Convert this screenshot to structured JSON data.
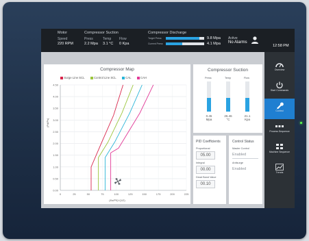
{
  "topbar": {
    "motor_label": "Motor",
    "speed_label": "Speed",
    "speed_value": "220 RPM",
    "compressor_suction_label": "Compressor Suction",
    "press_label": "Press",
    "press_value": "2.2 Mpa",
    "temp_label": "Temp",
    "temp_value": "3.1 °C",
    "flow_label": "Flow",
    "flow_value": "0 Kpa",
    "compressor_discharge_label": "Compressor Discharge",
    "target_press_label": "Target Press",
    "target_press_value": "9.8 Mpa",
    "target_press_fraction": 0.88,
    "current_press_label": "Current Press",
    "current_press_value": "4.1 Mpa",
    "current_press_fraction": 0.42,
    "alarm_label": "Active",
    "alarm_value": "No Alarms",
    "clock": "12:58 PM",
    "user_icon": "user-icon"
  },
  "sidebar": {
    "items": [
      {
        "label": "Overview",
        "icon": "gauge-icon",
        "active": false
      },
      {
        "label": "Start Commands",
        "icon": "power-icon",
        "active": false
      },
      {
        "label": "Control",
        "icon": "wrench-icon",
        "active": true
      },
      {
        "label": "Process Sequence",
        "icon": "sequence-icon",
        "active": false
      },
      {
        "label": "Machine Sequence",
        "icon": "machine-icon",
        "active": false
      },
      {
        "label": "Trends",
        "icon": "trend-icon",
        "active": false
      }
    ]
  },
  "compressor_map": {
    "title": "Compressor Map",
    "legend": [
      {
        "name": "Surge Line SCL",
        "color": "#d9254b"
      },
      {
        "name": "Control Line SCL",
        "color": "#9bc63c"
      },
      {
        "name": "CAL",
        "color": "#2ab5d8"
      },
      {
        "name": "CAH",
        "color": "#e23a97"
      }
    ],
    "xlabel": "(Ks/P0)^(1/2)",
    "ylabel": "(Pd/Ps)",
    "cursor_icon": "fan-icon"
  },
  "chart_data": {
    "type": "line",
    "title": "Compressor Map",
    "xlabel": "(Ks/P0)^(1/2)",
    "ylabel": "(Pd/Ps)",
    "xlim": [
      0,
      225
    ],
    "ylim": [
      0,
      4.5
    ],
    "x_ticks": [
      0,
      25,
      50,
      75,
      100,
      125,
      150,
      175,
      200,
      225
    ],
    "y_ticks": [
      "0.00",
      "0.50",
      "1.00",
      "1.50",
      "2.00",
      "2.50",
      "3.00",
      "3.50",
      "4.00",
      "4.50"
    ],
    "grid": true,
    "legend_position": "top",
    "series": [
      {
        "name": "Surge Line SCL",
        "color": "#d9254b",
        "points": [
          [
            55,
            0
          ],
          [
            55,
            1.0
          ],
          [
            74,
            2.05
          ],
          [
            95,
            3.2
          ],
          [
            112,
            4.5
          ]
        ]
      },
      {
        "name": "Control Line SCL",
        "color": "#9bc63c",
        "points": [
          [
            68,
            0
          ],
          [
            68,
            1.4
          ],
          [
            85,
            2.05
          ],
          [
            110,
            3.3
          ],
          [
            130,
            4.5
          ]
        ]
      },
      {
        "name": "CAL",
        "color": "#2ab5d8",
        "points": [
          [
            80,
            0
          ],
          [
            80,
            1.4
          ],
          [
            97,
            2.05
          ],
          [
            124,
            3.3
          ],
          [
            146,
            4.5
          ]
        ]
      },
      {
        "name": "CAH",
        "color": "#e23a97",
        "points": [
          [
            90,
            0
          ],
          [
            90,
            1.6
          ],
          [
            104,
            1.8
          ],
          [
            142,
            3.3
          ],
          [
            166,
            4.5
          ]
        ]
      }
    ]
  },
  "suction": {
    "title": "Compressor Suction",
    "gauges": [
      {
        "label": "Press",
        "value": "0.45",
        "unit": "Mpa",
        "fraction": 0.45
      },
      {
        "label": "Temp",
        "value": "26.46",
        "unit": "°C",
        "fraction": 0.45
      },
      {
        "label": "Flow",
        "value": "21.1",
        "unit": "Kpa",
        "fraction": 0.45
      }
    ]
  },
  "pid": {
    "title": "PID Coefficients",
    "proportional_label": "Proportional",
    "proportional_value": "05.00",
    "integral_label": "Integral",
    "integral_value": "00.00",
    "deadband_label": "Dead Band Value",
    "deadband_value": "00.10"
  },
  "control_status": {
    "title": "Control Status",
    "master_label": "Master Control",
    "master_value": "Enabled",
    "antisurge_label": "Antisurge",
    "antisurge_value": "Enabled"
  }
}
